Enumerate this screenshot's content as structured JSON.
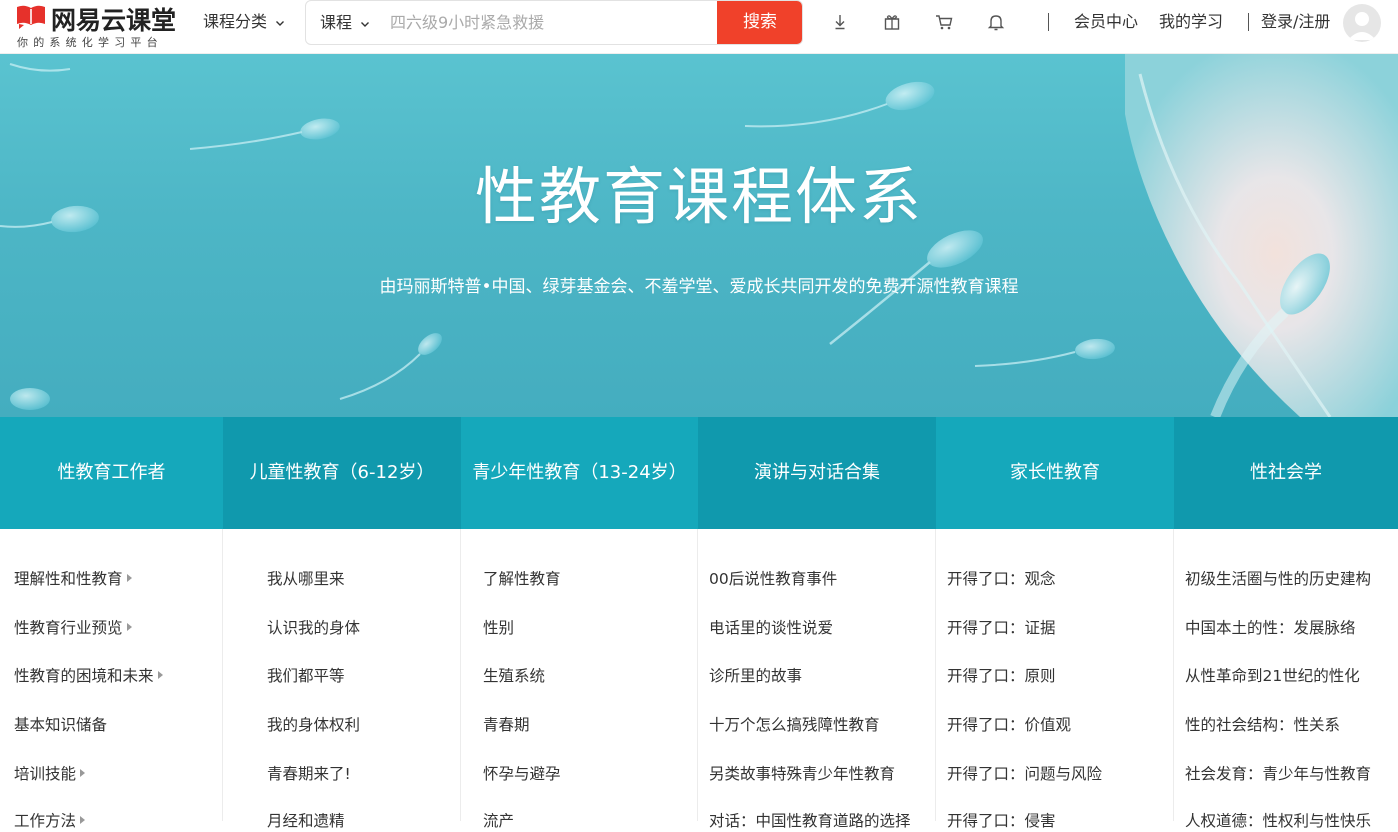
{
  "header": {
    "logo_name": "网易云课堂",
    "logo_slogan": "你的系统化学习平台",
    "category_label": "课程分类",
    "search": {
      "type_label": "课程",
      "placeholder": "四六级9小时紧急救援",
      "button_label": "搜索"
    },
    "icons": [
      "download-icon",
      "gift-icon",
      "cart-icon",
      "bell-icon"
    ],
    "member_center": "会员中心",
    "my_learning": "我的学习",
    "login_register": "登录/注册"
  },
  "banner": {
    "title": "性教育课程体系",
    "subtitle": "由玛丽斯特普•中国、绿芽基金会、不羞学堂、爱成长共同开发的免费开源性教育课程"
  },
  "tabs": [
    {
      "label": "性教育工作者"
    },
    {
      "label": "儿童性教育（6-12岁）"
    },
    {
      "label": "青少年性教育（13-24岁）"
    },
    {
      "label": "演讲与对话合集"
    },
    {
      "label": "家长性教育"
    },
    {
      "label": "性社会学"
    }
  ],
  "columns": [
    {
      "items": [
        {
          "label": "理解性和性教育",
          "has_arrow": true
        },
        {
          "label": "性教育行业预览",
          "has_arrow": true
        },
        {
          "label": "性教育的困境和未来",
          "has_arrow": true
        },
        {
          "label": "基本知识储备",
          "has_arrow": false
        },
        {
          "label": "培训技能",
          "has_arrow": true
        },
        {
          "label": "工作方法",
          "has_arrow": true
        }
      ]
    },
    {
      "items": [
        {
          "label": "我从哪里来"
        },
        {
          "label": "认识我的身体"
        },
        {
          "label": "我们都平等"
        },
        {
          "label": "我的身体权利"
        },
        {
          "label": "青春期来了!"
        },
        {
          "label": "月经和遗精"
        }
      ]
    },
    {
      "items": [
        {
          "label": "了解性教育"
        },
        {
          "label": "性别"
        },
        {
          "label": "生殖系统"
        },
        {
          "label": "青春期"
        },
        {
          "label": "怀孕与避孕"
        },
        {
          "label": "流产"
        }
      ]
    },
    {
      "items": [
        {
          "label": "00后说性教育事件"
        },
        {
          "label": "电话里的谈性说爱"
        },
        {
          "label": "诊所里的故事"
        },
        {
          "label": "十万个怎么搞残障性教育"
        },
        {
          "label": "另类故事特殊青少年性教育"
        },
        {
          "label": "对话：中国性教育道路的选择"
        }
      ]
    },
    {
      "items": [
        {
          "label": "开得了口：观念"
        },
        {
          "label": "开得了口：证据"
        },
        {
          "label": "开得了口：原则"
        },
        {
          "label": "开得了口：价值观"
        },
        {
          "label": "开得了口：问题与风险"
        },
        {
          "label": "开得了口：侵害"
        }
      ]
    },
    {
      "items": [
        {
          "label": "初级生活圈与性的历史建构"
        },
        {
          "label": "中国本土的性：发展脉络"
        },
        {
          "label": "从性革命到21世纪的性化"
        },
        {
          "label": "性的社会结构：性关系"
        },
        {
          "label": "社会发育：青少年与性教育"
        },
        {
          "label": "人权道德：性权利与性快乐"
        }
      ]
    }
  ],
  "colors": {
    "accent_red": "#f0412a",
    "tab_teal": "#15a8bb",
    "tab_teal_dark": "#1099ad",
    "banner_teal": "#4db6c6"
  }
}
